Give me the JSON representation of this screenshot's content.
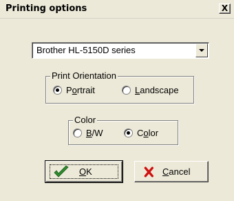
{
  "window": {
    "title": "Printing options",
    "close_label": "X"
  },
  "printer": {
    "selected": "Brother HL-5150D series"
  },
  "orientation": {
    "label": "Print Orientation",
    "options": [
      {
        "label": "Portrait",
        "mnemonic_index": 1,
        "checked": true
      },
      {
        "label": "Landscape",
        "mnemonic_index": 0,
        "checked": false
      }
    ]
  },
  "color": {
    "label": "Color",
    "options": [
      {
        "label": "B/W",
        "mnemonic_index": 0,
        "checked": false
      },
      {
        "label": "Color",
        "mnemonic_index": 1,
        "checked": true
      }
    ]
  },
  "buttons": {
    "ok_label": "OK",
    "ok_icon": "checkmark-icon",
    "cancel_label": "Cancel",
    "cancel_icon": "x-icon"
  },
  "colors": {
    "background": "#ece9d8",
    "ok_icon": "#2e8b2e",
    "cancel_icon": "#d01010"
  }
}
